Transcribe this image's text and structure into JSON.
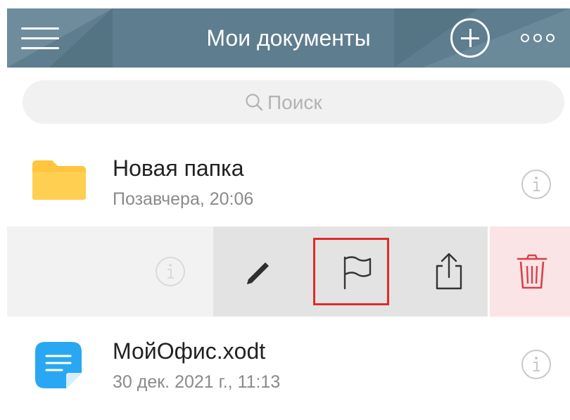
{
  "header": {
    "title": "Мои документы"
  },
  "search": {
    "placeholder": "Поиск"
  },
  "files": [
    {
      "name": "Новая папка",
      "date": "Позавчера, 20:06",
      "type": "folder"
    },
    {
      "name": "МойОфис.xodt",
      "date": "30 дек. 2021 г., 11:13",
      "type": "document"
    }
  ],
  "swipe_actions": [
    "rename",
    "flag",
    "share",
    "delete"
  ],
  "colors": {
    "header_bg": "#5e7d8e",
    "folder": "#ffc53d",
    "document": "#2aa7f2",
    "delete": "#d9404a",
    "highlight": "#e02b2b"
  },
  "icons": [
    "menu-icon",
    "add-icon",
    "more-icon",
    "search-icon",
    "folder-icon",
    "info-icon",
    "pencil-icon",
    "flag-icon",
    "share-icon",
    "trash-icon",
    "document-icon"
  ]
}
